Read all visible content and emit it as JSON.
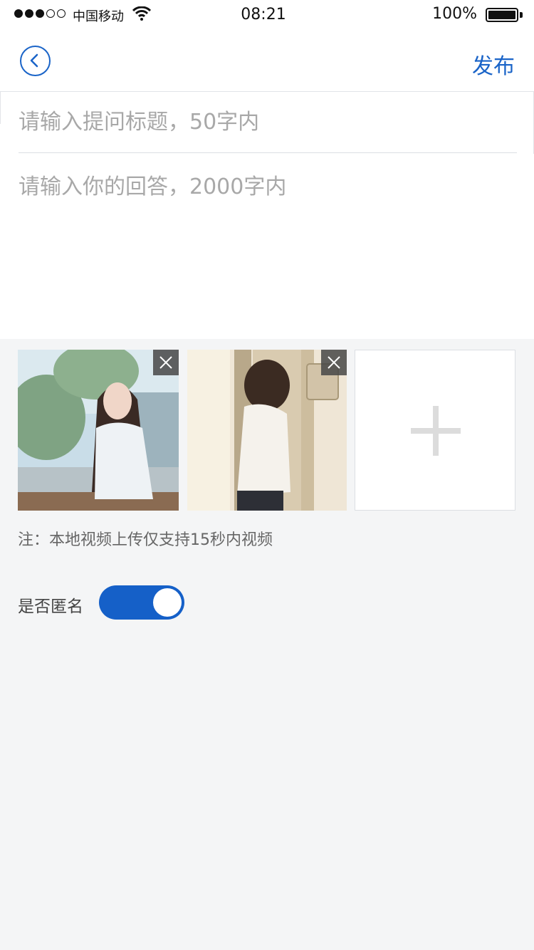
{
  "status_bar": {
    "carrier": "中国移动",
    "time": "08:21",
    "battery": "100%",
    "signal_bars_filled": 3,
    "signal_bars_total": 5
  },
  "nav": {
    "back_icon": "chevron-left-icon",
    "publish_label": "发布"
  },
  "form": {
    "title_placeholder": "请输入提问标题，50字内",
    "answer_placeholder": "请输入你的回答，2000字内"
  },
  "media": {
    "items": [
      {
        "kind": "photo",
        "description_icon": "photo-thumbnail",
        "remove_icon": "close-icon"
      },
      {
        "kind": "photo",
        "description_icon": "photo-thumbnail",
        "remove_icon": "close-icon"
      }
    ],
    "add_icon": "plus-icon"
  },
  "note": "注：本地视频上传仅支持15秒内视频",
  "anonymous": {
    "label": "是否匿名",
    "enabled": true
  },
  "colors": {
    "accent": "#1a64c8",
    "toggle_on": "#1560c8",
    "background": "#f4f5f6",
    "placeholder": "#a8a8a8"
  }
}
